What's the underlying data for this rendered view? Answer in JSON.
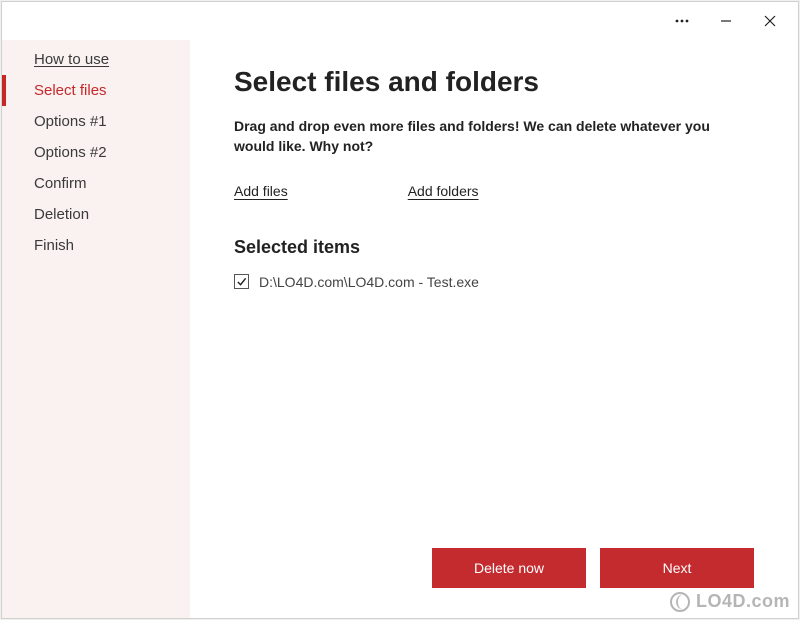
{
  "window": {
    "more_label": "More",
    "minimize_label": "Minimize",
    "close_label": "Close"
  },
  "sidebar": {
    "items": [
      {
        "label": "How to use",
        "active": false,
        "link": true
      },
      {
        "label": "Select files",
        "active": true,
        "link": false
      },
      {
        "label": "Options #1",
        "active": false,
        "link": false
      },
      {
        "label": "Options #2",
        "active": false,
        "link": false
      },
      {
        "label": "Confirm",
        "active": false,
        "link": false
      },
      {
        "label": "Deletion",
        "active": false,
        "link": false
      },
      {
        "label": "Finish",
        "active": false,
        "link": false
      }
    ]
  },
  "main": {
    "title": "Select files and folders",
    "instructions": "Drag and drop even more files and folders! We can delete whatever you would like. Why not?",
    "add_files_label": "Add files",
    "add_folders_label": "Add folders",
    "selected_heading": "Selected items",
    "selected_items": [
      {
        "checked": true,
        "path": "D:\\LO4D.com\\LO4D.com - Test.exe"
      }
    ]
  },
  "footer": {
    "delete_now_label": "Delete now",
    "next_label": "Next"
  },
  "watermark": "LO4D.com"
}
